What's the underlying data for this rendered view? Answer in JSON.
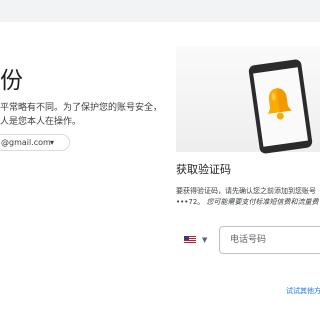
{
  "left": {
    "heading": "份",
    "description_lines": [
      "平常略有不同。为了保护您的账号安全，",
      "人是您本人在操作。"
    ],
    "account_email": "@gmail.com"
  },
  "right": {
    "section_title": "获取验证码",
    "verify_line1": "要获得验证码，请先确认您之前添加到您账号",
    "verify_line2_mask": "•••72。",
    "verify_line2_note": "您可能需要支付标准短信费和流量费",
    "phone_placeholder": "电话号码",
    "try_other_link": "试试其他方"
  },
  "icons": {
    "phone_illustration": "phone-bell-illustration",
    "flag": "us-flag-icon",
    "chevron": "chevron-down-icon"
  },
  "colors": {
    "link": "#1a73e8",
    "bell": "#f9ab00"
  }
}
